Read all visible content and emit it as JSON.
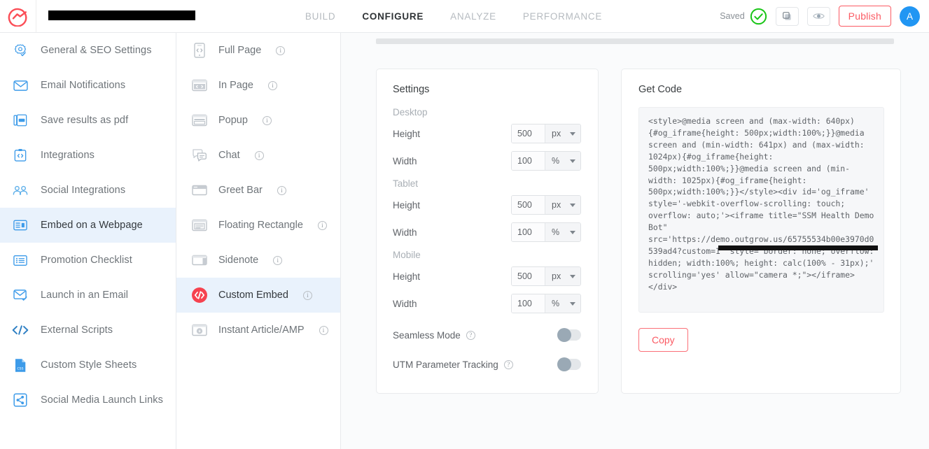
{
  "header": {
    "logo_icon": "outgrow-logo-icon",
    "project_title": "SSM Health Demo Bot",
    "title_redacted": true,
    "nav_tabs": [
      {
        "label": "BUILD",
        "active": false
      },
      {
        "label": "CONFIGURE",
        "active": true
      },
      {
        "label": "ANALYZE",
        "active": false
      },
      {
        "label": "PERFORMANCE",
        "active": false
      }
    ],
    "saved_label": "Saved",
    "saved_icon": "green-check-circle-icon",
    "duplicate_icon": "duplicate-icon",
    "preview_icon": "eye-preview-icon",
    "publish_label": "Publish",
    "avatar_initial": "A",
    "accent_red": "#fb5a63",
    "avatar_blue": "#2196f3",
    "check_green": "#18c516"
  },
  "sidebar": {
    "items": [
      {
        "label": "General & SEO Settings",
        "icon": "gear-check-icon",
        "active": false
      },
      {
        "label": "Email Notifications",
        "icon": "envelope-icon",
        "active": false
      },
      {
        "label": "Save results as pdf",
        "icon": "pdf-save-icon",
        "active": false
      },
      {
        "label": "Integrations",
        "icon": "integrations-code-icon",
        "active": false
      },
      {
        "label": "Social Integrations",
        "icon": "social-users-icon",
        "active": false
      },
      {
        "label": "Embed on a Webpage",
        "icon": "embed-window-icon",
        "active": true
      },
      {
        "label": "Promotion Checklist",
        "icon": "checklist-icon",
        "active": false
      },
      {
        "label": "Launch in an Email",
        "icon": "envelope-check-icon",
        "active": false
      },
      {
        "label": "External Scripts",
        "icon": "code-brackets-icon",
        "active": false
      },
      {
        "label": "Custom Style Sheets",
        "icon": "css-file-icon",
        "active": false
      },
      {
        "label": "Social Media Launch Links",
        "icon": "share-icon",
        "active": false
      }
    ],
    "active_bg": "#e9f2fc"
  },
  "embed_types": {
    "items": [
      {
        "label": "Full Page",
        "icon": "mobile-code-icon",
        "info": "i",
        "active": false
      },
      {
        "label": "In Page",
        "icon": "inpage-code-icon",
        "info": "i",
        "active": false
      },
      {
        "label": "Popup",
        "icon": "popup-window-icon",
        "info": "i",
        "active": false
      },
      {
        "label": "Chat",
        "icon": "chat-bubbles-icon",
        "info": "i",
        "active": false
      },
      {
        "label": "Greet Bar",
        "icon": "greet-bar-icon",
        "info": "i",
        "active": false
      },
      {
        "label": "Floating Rectangle",
        "icon": "floating-rectangle-icon",
        "info": "i",
        "active": false
      },
      {
        "label": "Sidenote",
        "icon": "sidenote-icon",
        "info": "i",
        "active": false
      },
      {
        "label": "Custom Embed",
        "icon": "custom-embed-code-icon",
        "info": "i",
        "active": true
      },
      {
        "label": "Instant Article/AMP",
        "icon": "instant-article-amp-icon",
        "info": "i",
        "active": false
      }
    ]
  },
  "settings_card": {
    "title": "Settings",
    "groups": [
      {
        "label": "Desktop",
        "fields": [
          {
            "label": "Height",
            "value": "500",
            "unit": "px"
          },
          {
            "label": "Width",
            "value": "100",
            "unit": "%"
          }
        ]
      },
      {
        "label": "Tablet",
        "fields": [
          {
            "label": "Height",
            "value": "500",
            "unit": "px"
          },
          {
            "label": "Width",
            "value": "100",
            "unit": "%"
          }
        ]
      },
      {
        "label": "Mobile",
        "fields": [
          {
            "label": "Height",
            "value": "500",
            "unit": "px"
          },
          {
            "label": "Width",
            "value": "100",
            "unit": "%"
          }
        ]
      }
    ],
    "toggles": [
      {
        "label": "Seamless Mode",
        "info": "?",
        "on": false
      },
      {
        "label": "UTM Parameter Tracking",
        "info": "?",
        "on": false
      }
    ]
  },
  "getcode_card": {
    "title": "Get Code",
    "code": "<style>@media screen and (max-width: 640px){#og_iframe{height: 500px;width:100%;}}@media screen and (min-width: 641px) and (max-width: 1024px){#og_iframe{height: 500px;width:100%;}}@media screen and (min-width: 1025px){#og_iframe{height: 500px;width:100%;}}</style><div id='og_iframe' style='-webkit-overflow-scrolling: touch; overflow: auto;'><iframe title=\"SSM Health Demo Bot\" src='https://demo.outgrow.us/65755534b00e3970d0539ad4?custom=1' style='border: none; overflow: hidden; width:100%; height: calc(100% - 31px);' scrolling='yes' allow=\"camera *;\"></iframe></div>",
    "url_redacted": true,
    "copy_label": "Copy"
  }
}
